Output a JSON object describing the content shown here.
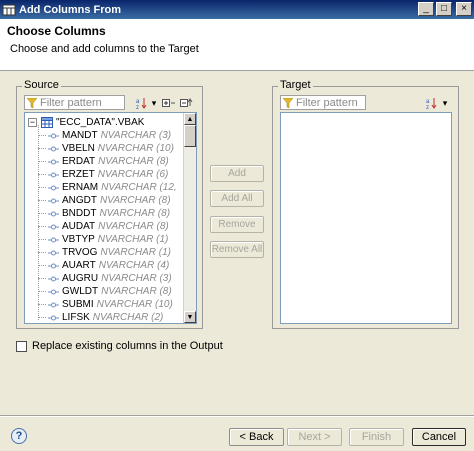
{
  "window": {
    "title": "Add Columns From",
    "buttons": {
      "minimize": "_",
      "maximize": "□",
      "close": "×"
    }
  },
  "header": {
    "title": "Choose Columns",
    "description": "Choose and add columns to the Target"
  },
  "source": {
    "label": "Source",
    "filter_placeholder": "Filter pattern",
    "root": "\"ECC_DATA\".VBAK",
    "expander": "−",
    "columns": [
      {
        "name": "MANDT",
        "type": "NVARCHAR (3)"
      },
      {
        "name": "VBELN",
        "type": "NVARCHAR (10)"
      },
      {
        "name": "ERDAT",
        "type": "NVARCHAR (8)"
      },
      {
        "name": "ERZET",
        "type": "NVARCHAR (6)"
      },
      {
        "name": "ERNAM",
        "type": "NVARCHAR (12,"
      },
      {
        "name": "ANGDT",
        "type": "NVARCHAR (8)"
      },
      {
        "name": "BNDDT",
        "type": "NVARCHAR (8)"
      },
      {
        "name": "AUDAT",
        "type": "NVARCHAR (8)"
      },
      {
        "name": "VBTYP",
        "type": "NVARCHAR (1)"
      },
      {
        "name": "TRVOG",
        "type": "NVARCHAR (1)"
      },
      {
        "name": "AUART",
        "type": "NVARCHAR (4)"
      },
      {
        "name": "AUGRU",
        "type": "NVARCHAR (3)"
      },
      {
        "name": "GWLDT",
        "type": "NVARCHAR (8)"
      },
      {
        "name": "SUBMI",
        "type": "NVARCHAR (10)"
      },
      {
        "name": "LIFSK",
        "type": "NVARCHAR (2)"
      }
    ]
  },
  "target": {
    "label": "Target",
    "filter_placeholder": "Filter pattern"
  },
  "middle_buttons": {
    "add": "Add",
    "add_all": "Add All",
    "remove": "Remove",
    "remove_all": "Remove All"
  },
  "options": {
    "replace_label": "Replace existing columns in the Output",
    "replace_checked": false
  },
  "footer": {
    "back": "< Back",
    "next": "Next >",
    "finish": "Finish",
    "cancel": "Cancel",
    "help": "?"
  }
}
